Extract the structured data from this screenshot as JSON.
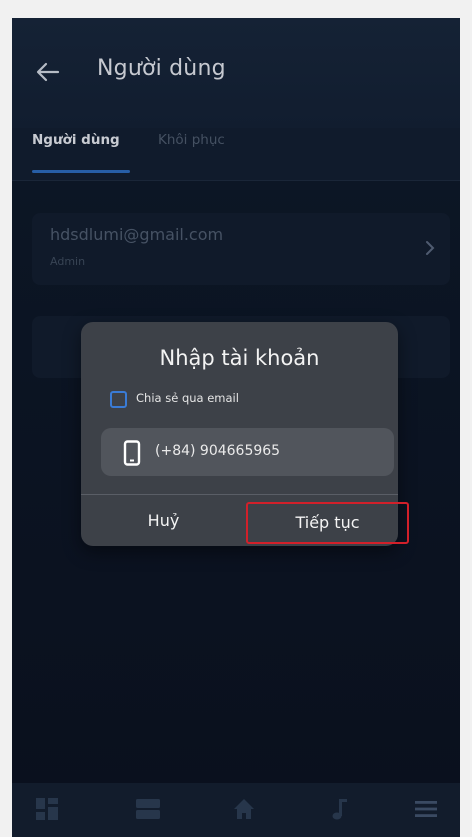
{
  "header": {
    "title": "Người dùng"
  },
  "tabs": [
    {
      "label": "Người dùng",
      "active": true
    },
    {
      "label": "Khôi phục",
      "active": false
    }
  ],
  "user": {
    "email": "hdsdlumi@gmail.com",
    "role": "Admin"
  },
  "dialog": {
    "title": "Nhập tài khoản",
    "share_label": "Chia sẻ qua email",
    "share_checked": false,
    "phone_value": "(+84) 904665965",
    "cancel_label": "Huỷ",
    "continue_label": "Tiếp tục"
  },
  "bottom_nav": {
    "items": [
      {
        "icon": "dashboard-icon"
      },
      {
        "icon": "rooms-icon"
      },
      {
        "icon": "home-icon"
      },
      {
        "icon": "music-icon"
      },
      {
        "icon": "menu-icon"
      }
    ]
  },
  "colors": {
    "accent": "#2b67b5",
    "highlight": "#d2202a",
    "dialog_bg": "#3d4148"
  }
}
